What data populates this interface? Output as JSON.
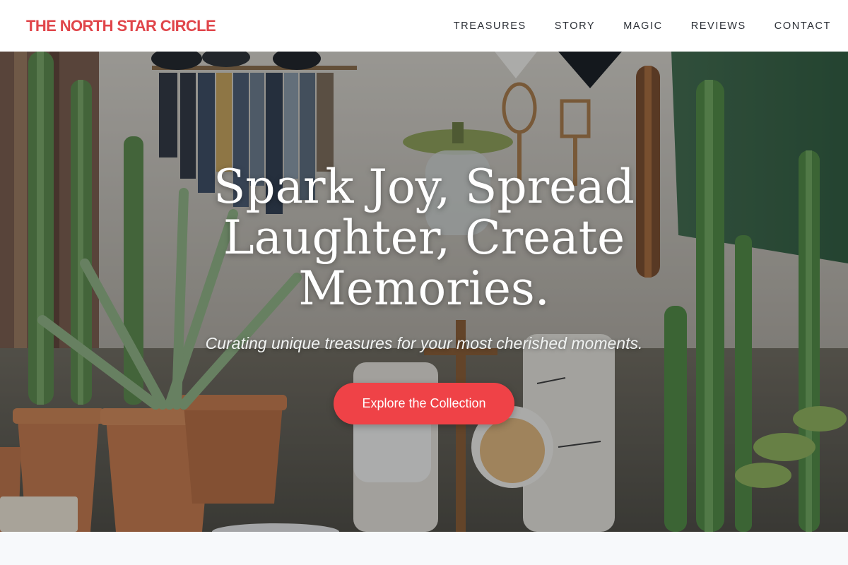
{
  "header": {
    "logo": "THE NORTH STAR CIRCLE",
    "nav": [
      "TREASURES",
      "STORY",
      "MAGIC",
      "REVIEWS",
      "CONTACT"
    ]
  },
  "hero": {
    "headline": "Spark Joy, Spread Laughter, Create Memories.",
    "subline": "Curating unique treasures for your most cherished moments.",
    "cta": "Explore the Collection"
  },
  "colors": {
    "accent": "#ef4247",
    "logo": "#e0454a",
    "nav_text": "#2b2f36",
    "footer_bg": "#f7f9fb"
  }
}
